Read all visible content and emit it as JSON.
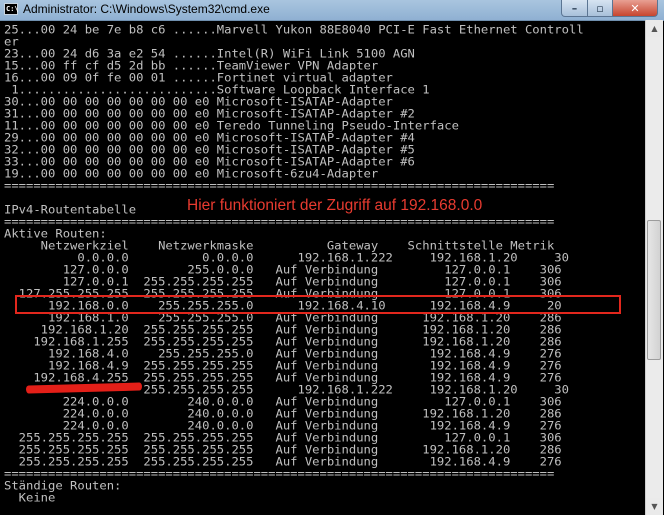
{
  "window": {
    "title": "Administrator: C:\\Windows\\System32\\cmd.exe",
    "icon": "cmd-icon",
    "buttons": {
      "minimize": "–",
      "maximize": "▫",
      "close": "✕"
    }
  },
  "console": {
    "interface_list": [
      "25...00 24 be 7e b8 c6 ......Marvell Yukon 88E8040 PCI-E Fast Ethernet Controll",
      "er",
      "23...00 24 d6 3a e2 54 ......Intel(R) WiFi Link 5100 AGN",
      "15...00 ff cf d5 2d bb ......TeamViewer VPN Adapter",
      "16...00 09 0f fe 00 01 ......Fortinet virtual adapter",
      " 1...........................Software Loopback Interface 1",
      "30...00 00 00 00 00 00 00 e0 Microsoft-ISATAP-Adapter",
      "31...00 00 00 00 00 00 00 e0 Microsoft-ISATAP-Adapter #2",
      "11...00 00 00 00 00 00 00 e0 Teredo Tunneling Pseudo-Interface",
      "29...00 00 00 00 00 00 00 e0 Microsoft-ISATAP-Adapter #4",
      "32...00 00 00 00 00 00 00 e0 Microsoft-ISATAP-Adapter #5",
      "33...00 00 00 00 00 00 00 e0 Microsoft-ISATAP-Adapter #6",
      "19...00 00 00 00 00 00 00 e0 Microsoft-6zu4-Adapter"
    ],
    "separator": "===========================================================================",
    "routing_title": "IPv4-Routentabelle",
    "active_routes_label": "Aktive Routen:",
    "routes_header": "     Netzwerkziel    Netzwerkmaske          Gateway    Schnittstelle Metrik",
    "routes": [
      "          0.0.0.0          0.0.0.0      192.168.1.222     192.168.1.20     30",
      "        127.0.0.0        255.0.0.0   Auf Verbindung         127.0.0.1    306",
      "        127.0.0.1  255.255.255.255   Auf Verbindung         127.0.0.1    306",
      "  127.255.255.255  255.255.255.255   Auf Verbindung         127.0.0.1    306",
      "      192.168.0.0    255.255.255.0      192.168.4.10      192.168.4.9     20",
      "      192.168.1.0    255.255.255.0   Auf Verbindung      192.168.1.20    286",
      "     192.168.1.20  255.255.255.255   Auf Verbindung      192.168.1.20    286",
      "    192.168.1.255  255.255.255.255   Auf Verbindung      192.168.1.20    286",
      "      192.168.4.0    255.255.255.0   Auf Verbindung       192.168.4.9    276",
      "      192.168.4.9  255.255.255.255   Auf Verbindung       192.168.4.9    276",
      "    192.168.4.255  255.255.255.255   Auf Verbindung       192.168.4.9    276",
      "                   255.255.255.255      192.168.1.222     192.168.1.20     30",
      "        224.0.0.0        240.0.0.0   Auf Verbindung         127.0.0.1    306",
      "        224.0.0.0        240.0.0.0   Auf Verbindung      192.168.1.20    286",
      "        224.0.0.0        240.0.0.0   Auf Verbindung       192.168.4.9    276",
      "  255.255.255.255  255.255.255.255   Auf Verbindung         127.0.0.1    306",
      "  255.255.255.255  255.255.255.255   Auf Verbindung      192.168.1.20    286",
      "  255.255.255.255  255.255.255.255   Auf Verbindung       192.168.4.9    276"
    ],
    "persistent_routes_label": "Ständige Routen:",
    "persistent_routes_value": "  Keine"
  },
  "annotations": {
    "note": "Hier funktioniert der Zugriff auf 192.168.0.0",
    "color": "#e2271d"
  },
  "scrollbar": {
    "up_arrow": "▲",
    "down_arrow": "▼"
  }
}
